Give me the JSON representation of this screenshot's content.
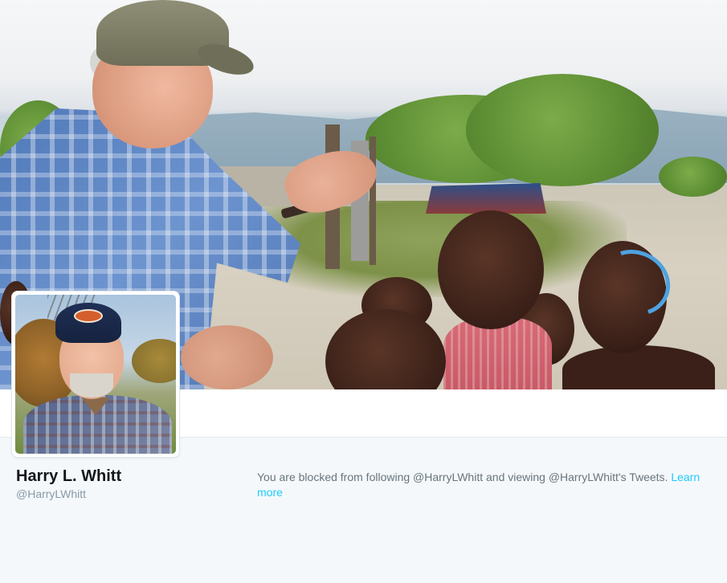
{
  "header": {
    "photo_description_icon": "header-photo"
  },
  "profile": {
    "name": "Harry L. Whitt",
    "handle": "@HarryLWhitt",
    "avatar_icon": "avatar"
  },
  "notice": {
    "text": "You are blocked from following @HarryLWhitt and viewing @HarryLWhitt's Tweets. ",
    "link_label": "Learn more"
  },
  "colors": {
    "link": "#1dcaff",
    "name": "#14171a",
    "handle": "#8899a6",
    "message": "#66757f",
    "canvas": "#f5f8fa"
  }
}
